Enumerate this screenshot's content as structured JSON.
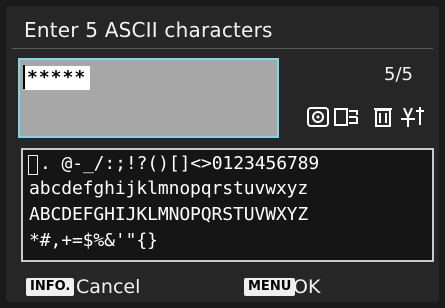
{
  "title": "Enter 5 ASCII characters",
  "entry": {
    "value": "*****"
  },
  "count": "5/5",
  "keyboard": {
    "row_1": ". @-_/:;!?()[]<>0123456789",
    "row_2": "abcdefghijklmnopqrstuvwxyz",
    "row_3": "ABCDEFGHIJKLMNOPQRSTUVWXYZ",
    "row_4": "*#,+=$%&'\"{}"
  },
  "bottom": {
    "info_badge": "INFO.",
    "cancel_label": "Cancel",
    "menu_badge": "MENU",
    "ok_label": "OK"
  },
  "colors": {
    "entry_border": "#7fd7e6",
    "entry_bg": "#a7a7a7"
  },
  "icons": [
    "quick-control-dial-icon",
    "main-dial-icon",
    "erase-icon",
    "rate-icon"
  ]
}
